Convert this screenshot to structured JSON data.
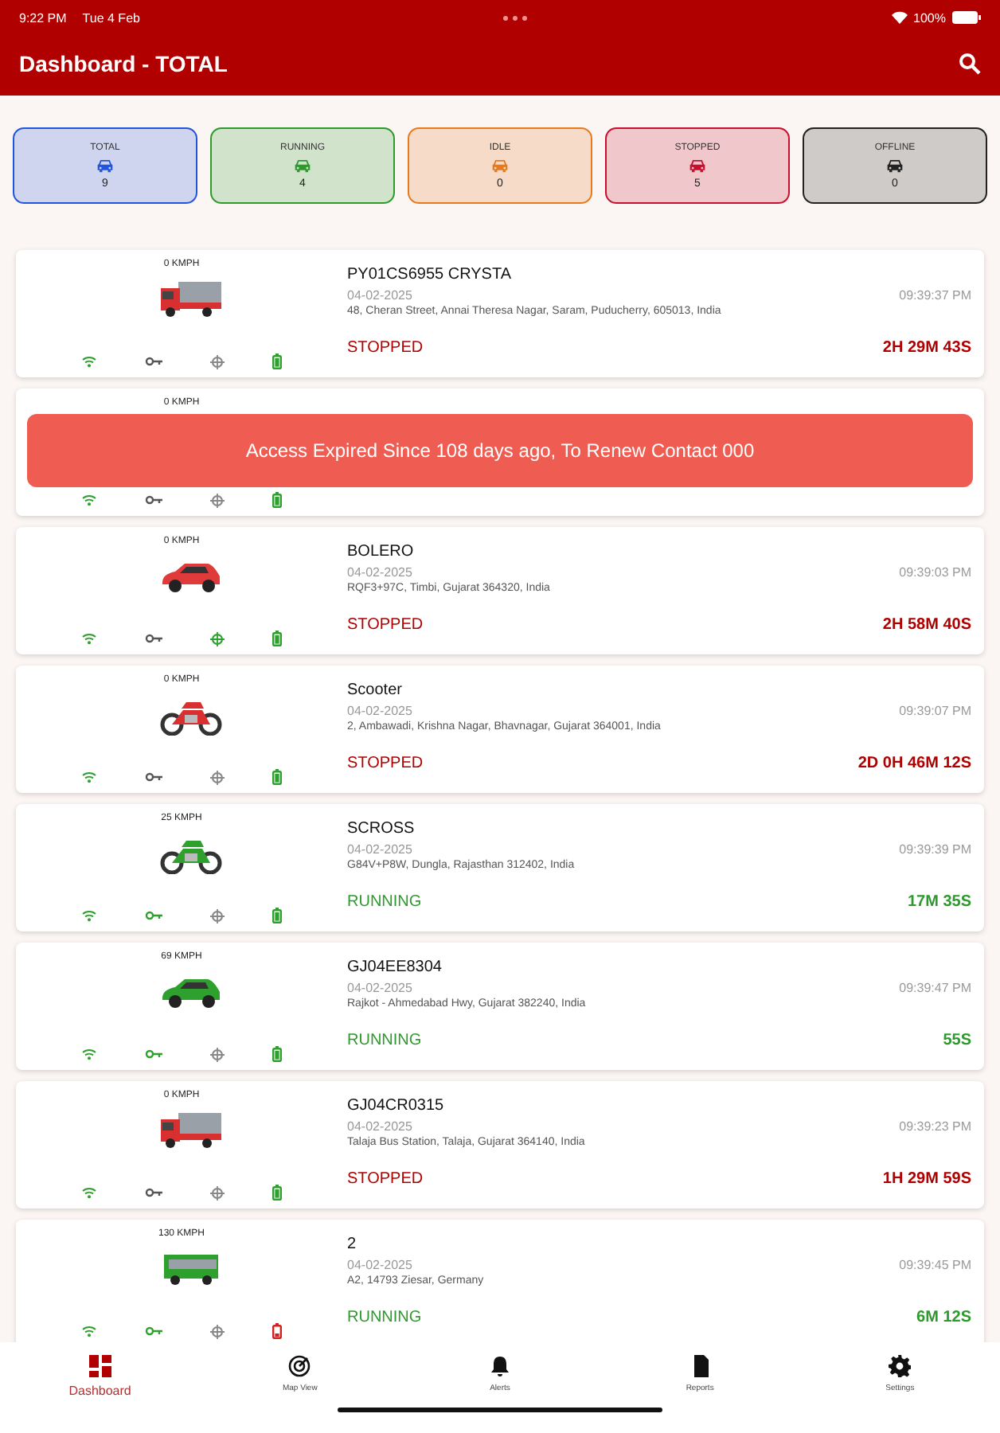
{
  "status_bar": {
    "time": "9:22 PM",
    "date": "Tue 4 Feb",
    "battery": "100%"
  },
  "app_bar": {
    "title": "Dashboard - TOTAL"
  },
  "summary": [
    {
      "label": "TOTAL",
      "count": "9",
      "color": "#2255dd"
    },
    {
      "label": "RUNNING",
      "count": "4",
      "color": "#2e9a2e"
    },
    {
      "label": "IDLE",
      "count": "0",
      "color": "#e87a1e"
    },
    {
      "label": "STOPPED",
      "count": "5",
      "color": "#c8102e"
    },
    {
      "label": "OFFLINE",
      "count": "0",
      "color": "#222222"
    }
  ],
  "vehicles": [
    {
      "speed": "0 KMPH",
      "kind": "truck",
      "color": "#d83030",
      "name": "PY01CS6955 CRYSTA",
      "date": "04-02-2025",
      "time": "09:39:37 PM",
      "address": "48, Cheran Street, Annai Theresa Nagar, Saram, Puducherry, 605013, India",
      "status": "STOPPED",
      "running": false,
      "duration": "2H 29M 43S",
      "network_on": true,
      "ignition_on": false,
      "gps_fix": false,
      "battery_low": false
    },
    {
      "speed": "0 KMPH",
      "toast": "Access Expired Since 108 days ago, To Renew Contact 000",
      "network_on": true,
      "ignition_on": false,
      "gps_fix": false,
      "battery_low": false
    },
    {
      "speed": "0 KMPH",
      "kind": "car",
      "color": "#e03a3a",
      "name": "BOLERO",
      "date": "04-02-2025",
      "time": "09:39:03 PM",
      "address": "RQF3+97C, Timbi, Gujarat 364320, India",
      "status": "STOPPED",
      "running": false,
      "duration": "2H 58M 40S",
      "network_on": true,
      "ignition_on": false,
      "gps_fix": true,
      "battery_low": false
    },
    {
      "speed": "0 KMPH",
      "kind": "bike",
      "color": "#d83030",
      "name": "Scooter",
      "date": "04-02-2025",
      "time": "09:39:07 PM",
      "address": "2, Ambawadi, Krishna Nagar, Bhavnagar, Gujarat 364001, India",
      "status": "STOPPED",
      "running": false,
      "duration": "2D 0H 46M 12S",
      "network_on": true,
      "ignition_on": false,
      "gps_fix": false,
      "battery_low": false
    },
    {
      "speed": "25 KMPH",
      "kind": "bike",
      "color": "#2ea02e",
      "name": "SCROSS",
      "date": "04-02-2025",
      "time": "09:39:39 PM",
      "address": "G84V+P8W, Dungla, Rajasthan 312402, India",
      "status": "RUNNING",
      "running": true,
      "duration": "17M 35S",
      "network_on": true,
      "ignition_on": true,
      "gps_fix": false,
      "battery_low": false
    },
    {
      "speed": "69 KMPH",
      "kind": "car",
      "color": "#2ea02e",
      "name": "GJ04EE8304",
      "date": "04-02-2025",
      "time": "09:39:47 PM",
      "address": "Rajkot - Ahmedabad Hwy, Gujarat 382240, India",
      "status": "RUNNING",
      "running": true,
      "duration": "55S",
      "network_on": true,
      "ignition_on": true,
      "gps_fix": false,
      "battery_low": false
    },
    {
      "speed": "0 KMPH",
      "kind": "truck",
      "color": "#d83030",
      "name": "GJ04CR0315",
      "date": "04-02-2025",
      "time": "09:39:23 PM",
      "address": "Talaja Bus Station, Talaja, Gujarat 364140, India",
      "status": "STOPPED",
      "running": false,
      "duration": "1H 29M 59S",
      "network_on": true,
      "ignition_on": false,
      "gps_fix": false,
      "battery_low": false
    },
    {
      "speed": "130 KMPH",
      "kind": "bus",
      "color": "#2ea02e",
      "name": "2",
      "date": "04-02-2025",
      "time": "09:39:45 PM",
      "address": "A2, 14793 Ziesar, Germany",
      "status": "RUNNING",
      "running": true,
      "duration": "6M 12S",
      "network_on": true,
      "ignition_on": true,
      "gps_fix": false,
      "battery_low": true
    }
  ],
  "bottom_nav": [
    {
      "label": "Dashboard",
      "selected": true
    },
    {
      "label": "Map View",
      "selected": false
    },
    {
      "label": "Alerts",
      "selected": false
    },
    {
      "label": "Reports",
      "selected": false
    },
    {
      "label": "Settings",
      "selected": false
    }
  ]
}
